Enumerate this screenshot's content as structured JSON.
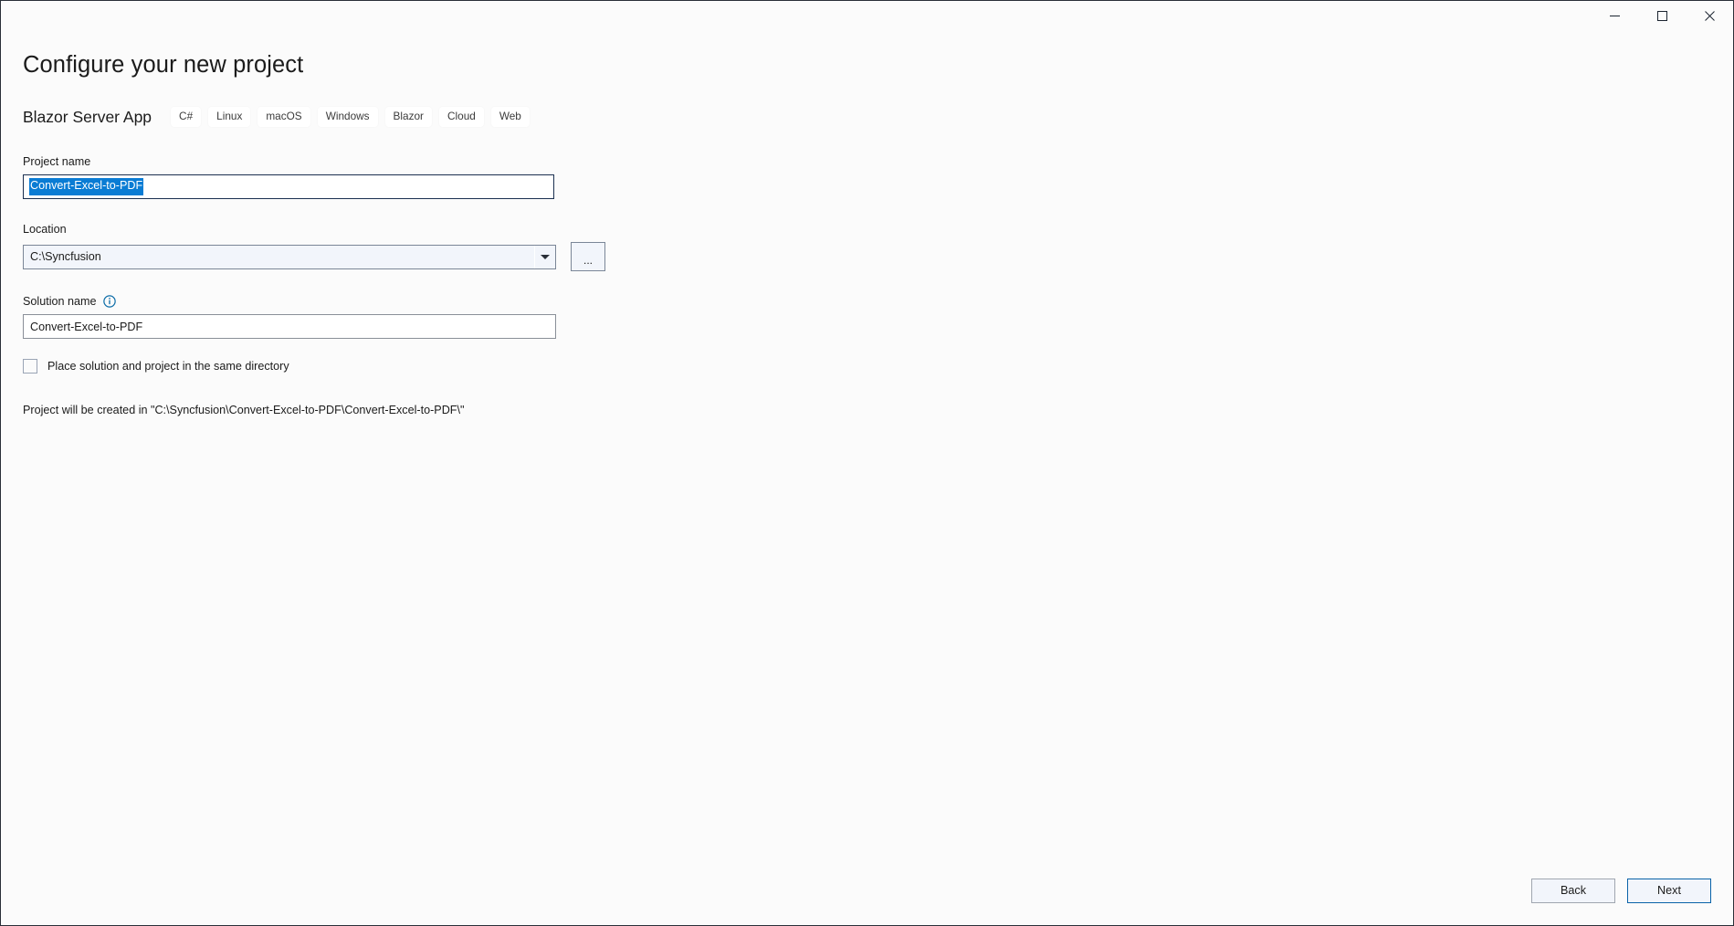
{
  "window": {
    "controls": {
      "minimize": "minimize-icon",
      "maximize": "maximize-icon",
      "close": "close-icon"
    }
  },
  "header": {
    "title": "Configure your new project"
  },
  "template": {
    "name": "Blazor Server App",
    "tags": [
      "C#",
      "Linux",
      "macOS",
      "Windows",
      "Blazor",
      "Cloud",
      "Web"
    ]
  },
  "form": {
    "project_name": {
      "label": "Project name",
      "value": "Convert-Excel-to-PDF",
      "selected": true
    },
    "location": {
      "label": "Location",
      "value": "C:\\Syncfusion",
      "browse_label": "...",
      "dropdown_icon": "chevron-down-icon"
    },
    "solution_name": {
      "label": "Solution name",
      "value": "Convert-Excel-to-PDF",
      "info_icon": "info-icon"
    },
    "same_directory": {
      "label": "Place solution and project in the same directory",
      "checked": false
    },
    "created_note": "Project will be created in \"C:\\Syncfusion\\Convert-Excel-to-PDF\\Convert-Excel-to-PDF\\\""
  },
  "footer": {
    "back_label": "Back",
    "next_label": "Next"
  },
  "colors": {
    "selection_blue": "#0a7cd4",
    "focus_border": "#1b3050",
    "primary_border": "#0a63a8",
    "info_icon": "#0e6ea8",
    "window_bg": "#fbfbfb"
  }
}
